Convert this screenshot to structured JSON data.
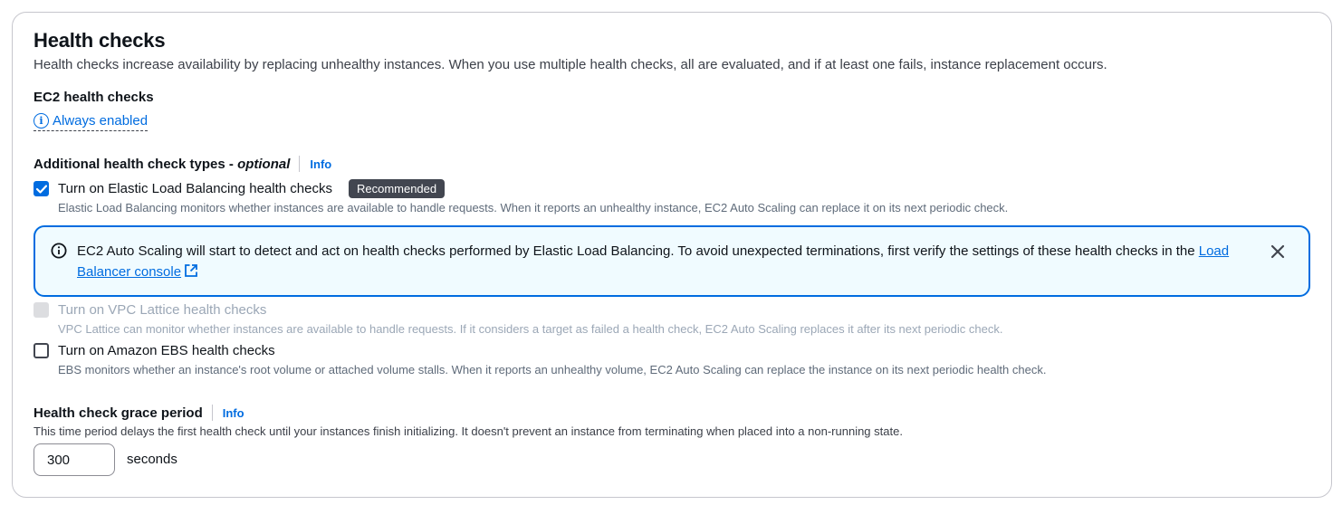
{
  "section": {
    "title": "Health checks",
    "description": "Health checks increase availability by replacing unhealthy instances. When you use multiple health checks, all are evaluated, and if at least one fails, instance replacement occurs."
  },
  "ec2": {
    "label": "EC2 health checks",
    "status": "Always enabled",
    "status_icon": "info-icon"
  },
  "additional": {
    "label": "Additional health check types -",
    "label_suffix": "optional",
    "info": "Info"
  },
  "options": {
    "elb": {
      "label": "Turn on Elastic Load Balancing health checks",
      "badge": "Recommended",
      "description": "Elastic Load Balancing monitors whether instances are available to handle requests. When it reports an unhealthy instance, EC2 Auto Scaling can replace it on its next periodic check.",
      "checked": true
    },
    "vpc": {
      "label": "Turn on VPC Lattice health checks",
      "description": "VPC Lattice can monitor whether instances are available to handle requests. If it considers a target as failed a health check, EC2 Auto Scaling replaces it after its next periodic check.",
      "checked": false,
      "disabled": true
    },
    "ebs": {
      "label": "Turn on Amazon EBS health checks",
      "description": "EBS monitors whether an instance's root volume or attached volume stalls. When it reports an unhealthy volume, EC2 Auto Scaling can replace the instance on its next periodic health check.",
      "checked": false
    }
  },
  "alert": {
    "text": "EC2 Auto Scaling will start to detect and act on health checks performed by Elastic Load Balancing. To avoid unexpected terminations, first verify the settings of these health checks in the",
    "link": "Load Balancer console"
  },
  "grace": {
    "label": "Health check grace period",
    "info": "Info",
    "description": "This time period delays the first health check until your instances finish initializing. It doesn't prevent an instance from terminating when placed into a non-running state.",
    "value": "300",
    "unit": "seconds"
  },
  "colors": {
    "link": "#006ce0",
    "alert_bg": "#f0fbff",
    "badge_bg": "#424650"
  }
}
